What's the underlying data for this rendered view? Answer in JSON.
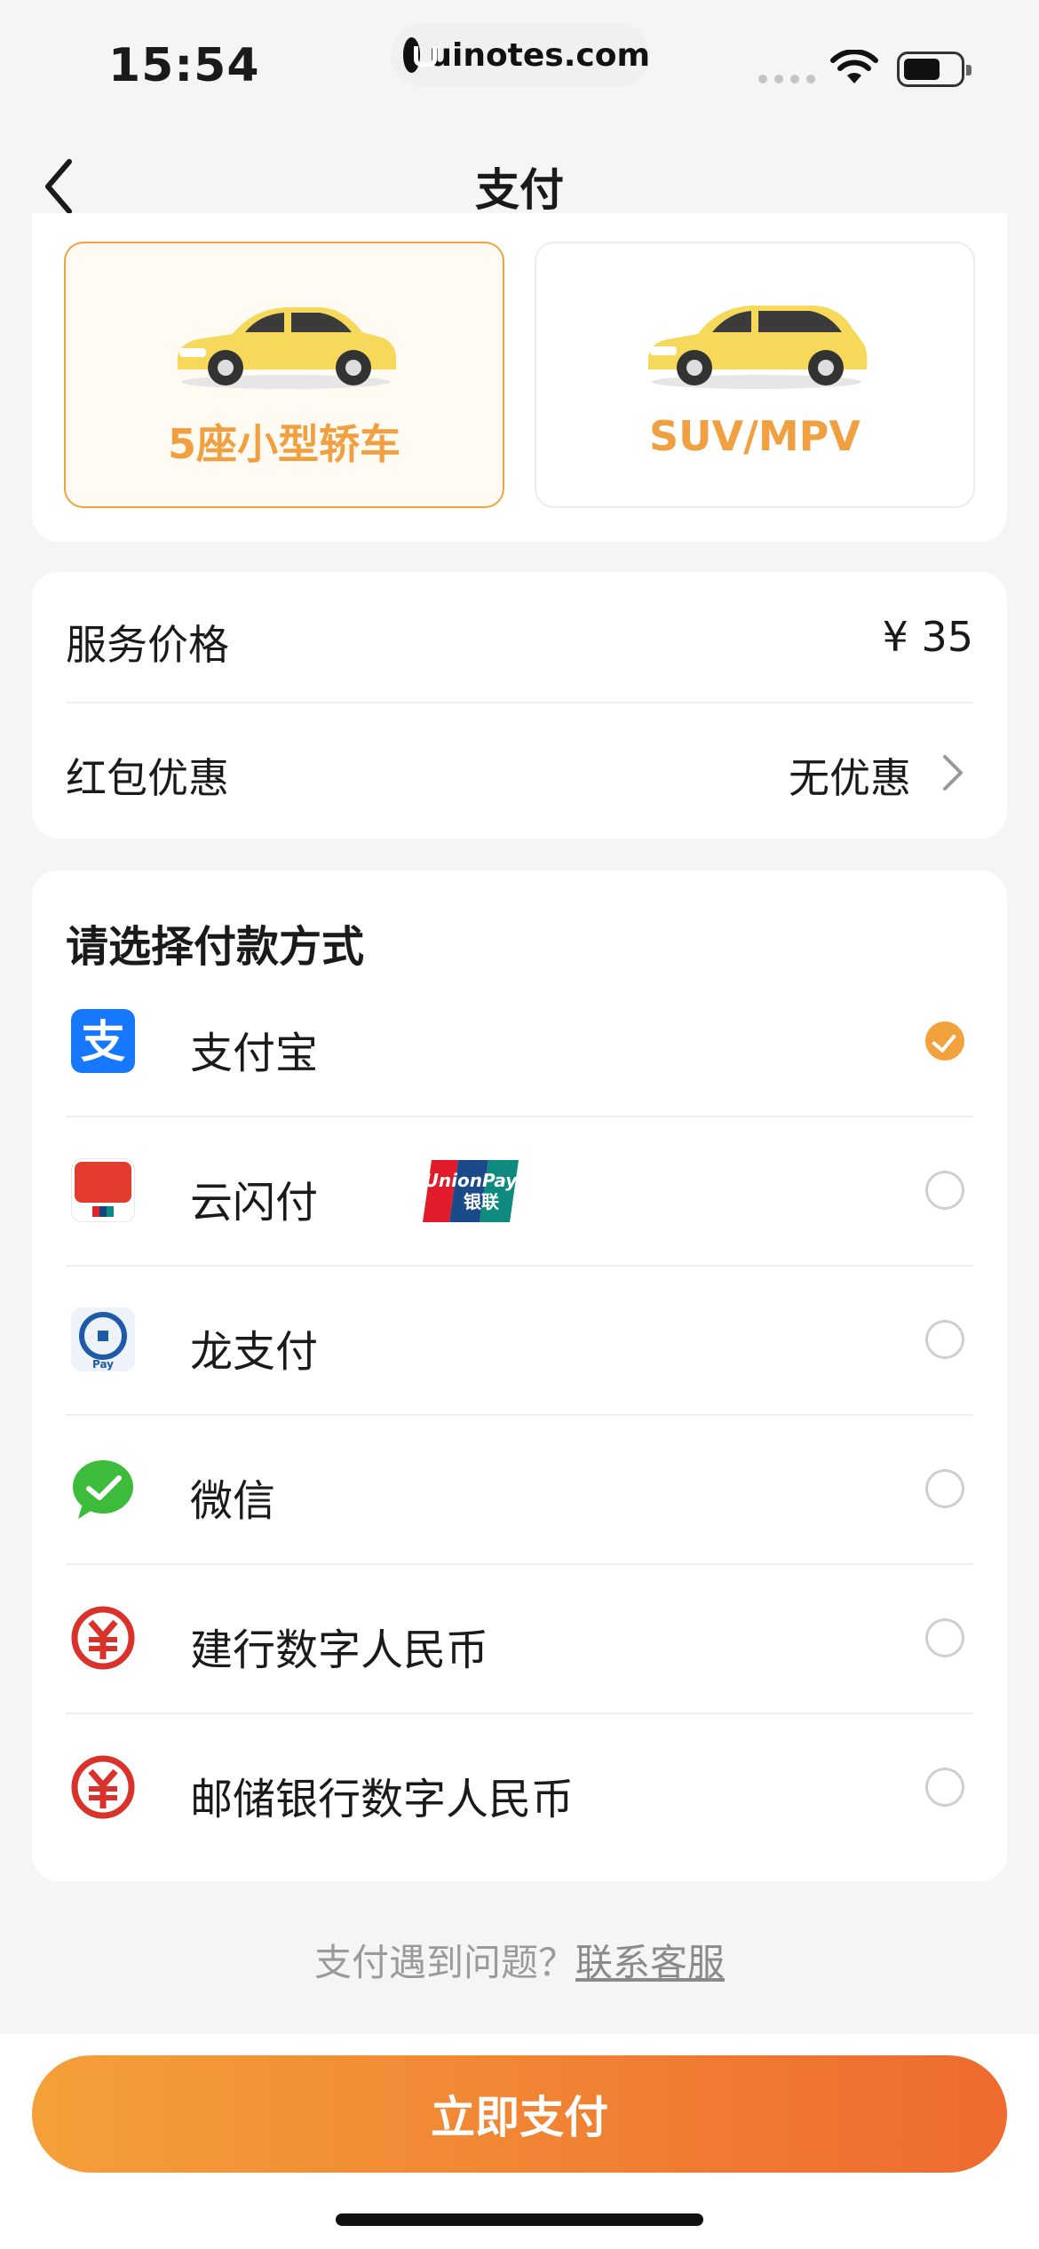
{
  "status_bar": {
    "time": "15:54",
    "url": "uinotes.com"
  },
  "nav": {
    "title": "支付",
    "back_icon": "chevron-left-icon"
  },
  "vehicles": [
    {
      "label": "5座小型轿车",
      "selected": true,
      "icon": "sedan-car-icon"
    },
    {
      "label": "SUV/MPV",
      "selected": false,
      "icon": "suv-car-icon"
    }
  ],
  "price": {
    "service_label": "服务价格",
    "service_value": "¥ 35",
    "coupon_label": "红包优惠",
    "coupon_value": "无优惠"
  },
  "payment": {
    "heading": "请选择付款方式",
    "methods": [
      {
        "label": "支付宝",
        "icon": "alipay-icon",
        "checked": true
      },
      {
        "label": "云闪付",
        "icon": "cloud-quickpass-icon",
        "checked": false,
        "badge_icon": "unionpay-badge-icon"
      },
      {
        "label": "龙支付",
        "icon": "long-pay-icon",
        "checked": false
      },
      {
        "label": "微信",
        "icon": "wechat-icon",
        "checked": false
      },
      {
        "label": "建行数字人民币",
        "icon": "digital-rmb-icon",
        "checked": false
      },
      {
        "label": "邮储银行数字人民币",
        "icon": "digital-rmb-icon",
        "checked": false
      }
    ]
  },
  "help": {
    "question": "支付遇到问题？",
    "link": "联系客服"
  },
  "cta": {
    "label": "立即支付"
  },
  "colors": {
    "accent": "#f2a23d",
    "gradient_start": "#f4a03a",
    "gradient_end": "#ee6a2e",
    "background": "#f5f5f5"
  }
}
